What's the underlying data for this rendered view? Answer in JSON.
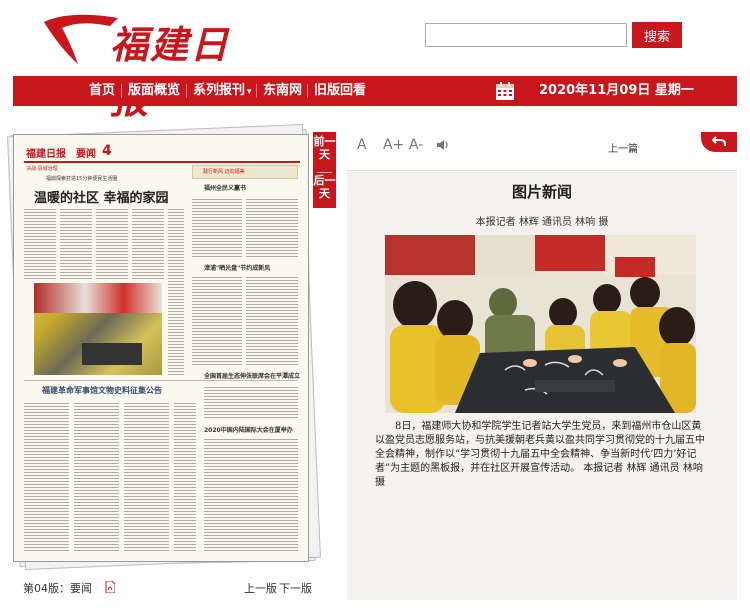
{
  "header": {
    "logo_text": "福建日报",
    "search": {
      "value": "",
      "placeholder": ""
    },
    "search_button": "搜索"
  },
  "nav": {
    "items": [
      "首页",
      "版面概览",
      "系列报刊",
      "东南网",
      "旧版回看"
    ],
    "dropdown_marker": "▾",
    "date": "2020年11月09日 星期一"
  },
  "side_tabs": [
    "前一天",
    "后一天"
  ],
  "newspaper": {
    "brand": "福建日报",
    "section": "要闻",
    "page_num": "4",
    "headline": "温暖的社区 幸福的家园",
    "kicker": "决战·县城治理",
    "sub": "福鼎探索打造15分钟便民生活圈",
    "right_box": "践行新风 迈向福美",
    "right_heads": [
      "福州全民义赢书",
      "漳浦\"晒光盘\"节约成新风"
    ],
    "lower_heads": [
      "福建革命军事馆文物史料征集公告",
      "全国首届生态伸张联席会在平潭成立",
      "2020中国内陆国际大会在厦举办"
    ]
  },
  "pagebar": {
    "page_label": "第04版：要闻",
    "prev": "上一版",
    "next": "下一版"
  },
  "article": {
    "font_controls": [
      "A",
      "A+",
      "A-"
    ],
    "prev_article": "上一篇",
    "title": "图片新闻",
    "byline": "本报记者 林辉  通讯员 林响 摄",
    "caption": "8日，福建师大协和学院学生记者站大学生党员，来到福州市仓山区黄以盈党员志愿服务站，与抗美援朝老兵黄以盈共同学习贯彻党的十九届五中全会精神，制作以“学习贯彻十九届五中全会精神、争当新时代‘四力’好记者”为主题的黑板报，并在社区开展宣传活动。 本报记者 林辉  通讯员 林响 摄"
  },
  "colors": {
    "brand_red": "#c8161d"
  }
}
